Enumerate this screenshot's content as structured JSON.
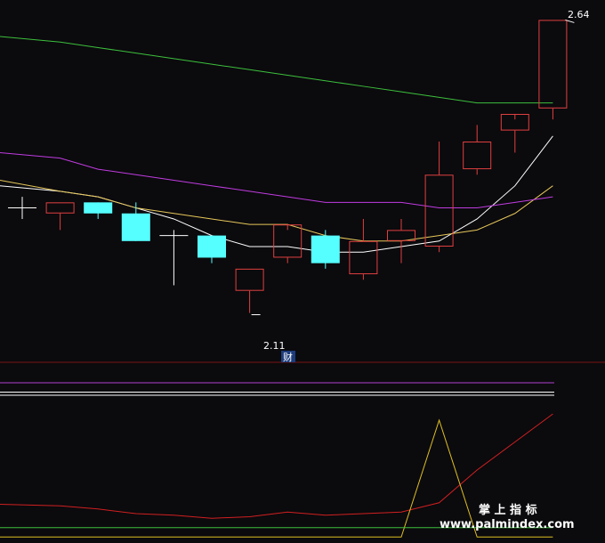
{
  "colors": {
    "background": "#0b0a0d",
    "bull": "#e04040",
    "bear": "#55ffff",
    "ma_white": "#ffffff",
    "ma_yellow": "#e6c85a",
    "ma_magenta": "#c03ce0",
    "ma_green": "#3cc03c",
    "separator": "#7a1414",
    "ind_magenta": "#b040d0",
    "ind_white": "#ffffff",
    "ind_red": "#d02020",
    "ind_green": "#3cc03c",
    "ind_yellow": "#e0c020"
  },
  "chart_data": [
    {
      "type": "candlestick",
      "ylim": [
        2.04,
        2.66
      ],
      "high_label": "2.64",
      "low_label": "2.11",
      "marker_text": "财",
      "marker_index": 7,
      "candles": [
        {
          "o": 2.3,
          "h": 2.32,
          "l": 2.28,
          "c": 2.3
        },
        {
          "o": 2.29,
          "h": 2.31,
          "l": 2.26,
          "c": 2.31
        },
        {
          "o": 2.31,
          "h": 2.31,
          "l": 2.28,
          "c": 2.29
        },
        {
          "o": 2.29,
          "h": 2.31,
          "l": 2.24,
          "c": 2.24
        },
        {
          "o": 2.25,
          "h": 2.26,
          "l": 2.16,
          "c": 2.25
        },
        {
          "o": 2.25,
          "h": 2.25,
          "l": 2.2,
          "c": 2.21
        },
        {
          "o": 2.15,
          "h": 2.19,
          "l": 2.11,
          "c": 2.19
        },
        {
          "o": 2.21,
          "h": 2.26,
          "l": 2.2,
          "c": 2.27
        },
        {
          "o": 2.25,
          "h": 2.26,
          "l": 2.19,
          "c": 2.2
        },
        {
          "o": 2.18,
          "h": 2.28,
          "l": 2.17,
          "c": 2.24
        },
        {
          "o": 2.24,
          "h": 2.28,
          "l": 2.2,
          "c": 2.26
        },
        {
          "o": 2.23,
          "h": 2.42,
          "l": 2.22,
          "c": 2.36
        },
        {
          "o": 2.37,
          "h": 2.45,
          "l": 2.36,
          "c": 2.42
        },
        {
          "o": 2.44,
          "h": 2.46,
          "l": 2.4,
          "c": 2.47
        },
        {
          "o": 2.48,
          "h": 2.64,
          "l": 2.46,
          "c": 2.64
        }
      ],
      "ma_series": [
        {
          "color_key": "ma_white",
          "values": [
            2.34,
            2.33,
            2.32,
            2.3,
            2.28,
            2.25,
            2.23,
            2.23,
            2.22,
            2.22,
            2.23,
            2.24,
            2.28,
            2.34,
            2.43
          ]
        },
        {
          "color_key": "ma_yellow",
          "values": [
            2.35,
            2.33,
            2.32,
            2.3,
            2.29,
            2.28,
            2.27,
            2.27,
            2.25,
            2.24,
            2.24,
            2.25,
            2.26,
            2.29,
            2.34
          ]
        },
        {
          "color_key": "ma_magenta",
          "values": [
            2.4,
            2.39,
            2.37,
            2.36,
            2.35,
            2.34,
            2.33,
            2.32,
            2.31,
            2.31,
            2.31,
            2.3,
            2.3,
            2.31,
            2.32
          ]
        },
        {
          "color_key": "ma_green",
          "values": [
            2.61,
            2.6,
            2.59,
            2.58,
            2.57,
            2.56,
            2.55,
            2.54,
            2.53,
            2.52,
            2.51,
            2.5,
            2.49,
            2.49,
            2.49
          ]
        }
      ]
    },
    {
      "type": "line",
      "ylim": [
        0,
        100
      ],
      "hlines": [
        {
          "color_key": "ind_magenta",
          "y": 100
        },
        {
          "color_key": "ind_white",
          "y": 94
        },
        {
          "color_key": "ind_white",
          "y": 92
        }
      ],
      "series": [
        {
          "color_key": "ind_red",
          "values": [
            22,
            21,
            19,
            16,
            15,
            13,
            14,
            17,
            15,
            16,
            17,
            23,
            44,
            62,
            80
          ]
        },
        {
          "color_key": "ind_yellow",
          "values": [
            1,
            1,
            1,
            1,
            1,
            1,
            1,
            1,
            1,
            1,
            1,
            76,
            1,
            1,
            1
          ]
        },
        {
          "color_key": "ind_green",
          "values": [
            7,
            7,
            7,
            7,
            7,
            7,
            7,
            7,
            7,
            7,
            7,
            7,
            7,
            7,
            7
          ]
        }
      ]
    }
  ],
  "watermark": {
    "line1": "掌 上 指 标",
    "line2": "www.palmindex.com"
  }
}
